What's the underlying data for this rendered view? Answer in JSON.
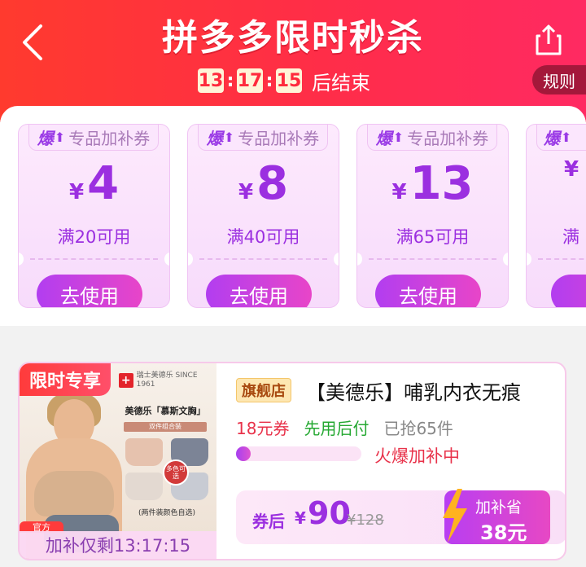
{
  "header": {
    "title": "拼多多限时秒杀",
    "countdown": {
      "hours": "13",
      "minutes": "17",
      "seconds": "15",
      "separator": ":",
      "suffix": "后结束"
    },
    "rules_label": "规则",
    "background_color": "#ff2d48"
  },
  "coupons": [
    {
      "tag_prefix": "爆",
      "tag_label": "专品加补券",
      "currency": "¥",
      "amount": "4",
      "condition": "满20可用",
      "button_label": "去使用"
    },
    {
      "tag_prefix": "爆",
      "tag_label": "专品加补券",
      "currency": "¥",
      "amount": "8",
      "condition": "满40可用",
      "button_label": "去使用"
    },
    {
      "tag_prefix": "爆",
      "tag_label": "专品加补券",
      "currency": "¥",
      "amount": "13",
      "condition": "满65可用",
      "button_label": "去使用"
    },
    {
      "tag_prefix": "爆",
      "tag_label": "",
      "currency": "¥",
      "amount": "",
      "condition": "满",
      "button_label": ""
    }
  ],
  "product": {
    "limit_badge": "限时专享",
    "image": {
      "brand_mark": "+",
      "brand_text": "瑞士美德乐 SINCE 1961",
      "headline": "美德乐「慕斯文胸」",
      "strip_text": "双件组合装",
      "multi_badge": "多色可选",
      "note": "(两件装颜色自选)",
      "bottom_tag": "官方"
    },
    "bottom_timer": "加补仅剩13:17:15",
    "store_badge": "旗舰店",
    "title": "【美德乐】哺乳内衣无痕",
    "coupon_text": "18元券",
    "pay_later_text": "先用后付",
    "sold_text": "已抢65件",
    "progress_fraction": 0.1,
    "progress_label": "火爆加补中",
    "after_coupon_label": "券后",
    "currency": "¥",
    "after_coupon_price": "90",
    "original_price": "¥128",
    "subsidy_label": "加补省",
    "subsidy_amount": "38元",
    "accent_color": "#9b2fe0"
  }
}
